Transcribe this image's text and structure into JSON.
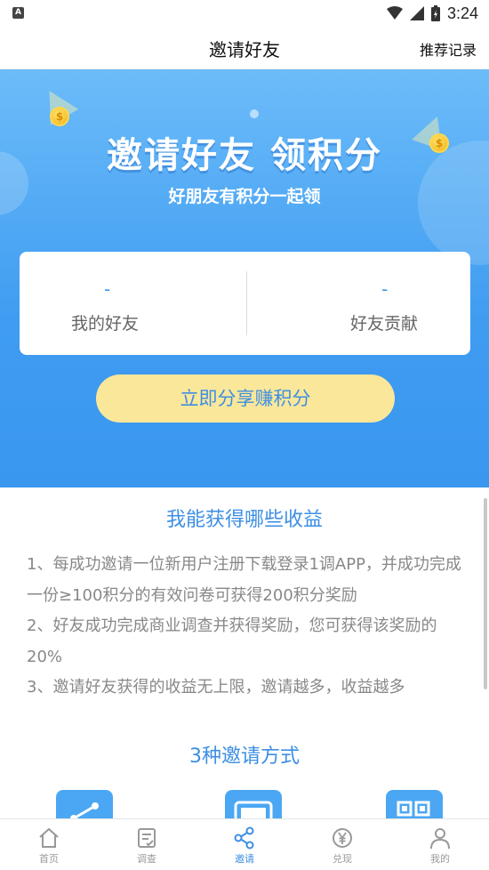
{
  "status_bar": {
    "app_glyph": "A",
    "time": "3:24"
  },
  "header": {
    "title": "邀请好友",
    "record_link": "推荐记录"
  },
  "hero": {
    "headline": "邀请好友 领积分",
    "subline": "好朋友有积分一起领",
    "coin_symbol": "$"
  },
  "stats": {
    "friends_value": "-",
    "friends_label": "我的好友",
    "contribution_value": "-",
    "contribution_label": "好友贡献"
  },
  "share_button_label": "立即分享赚积分",
  "benefits": {
    "title": "我能获得哪些收益",
    "items": [
      "1、每成功邀请一位新用户注册下载登录1调APP，并成功完成一份≥100积分的有效问卷可获得200积分奖励",
      "2、好友成功完成商业调查并获得奖励，您可获得该奖励的20%",
      "3、邀请好友获得的收益无上限，邀请越多，收益越多"
    ]
  },
  "methods": {
    "title": "3种邀请方式",
    "icons": [
      "share-link-icon",
      "image-icon",
      "qr-code-icon"
    ]
  },
  "bottom_nav": {
    "items": [
      {
        "label": "首页",
        "icon": "home-icon"
      },
      {
        "label": "调查",
        "icon": "survey-icon"
      },
      {
        "label": "邀请",
        "icon": "share-icon"
      },
      {
        "label": "兑现",
        "icon": "yuan-icon"
      },
      {
        "label": "我的",
        "icon": "user-icon"
      }
    ],
    "active_index": 2
  },
  "colors": {
    "accent_blue": "#3d8fe3",
    "button_yellow": "#fbe79a",
    "hero_top": "#6cbcf9",
    "hero_bottom": "#3a97ef"
  }
}
